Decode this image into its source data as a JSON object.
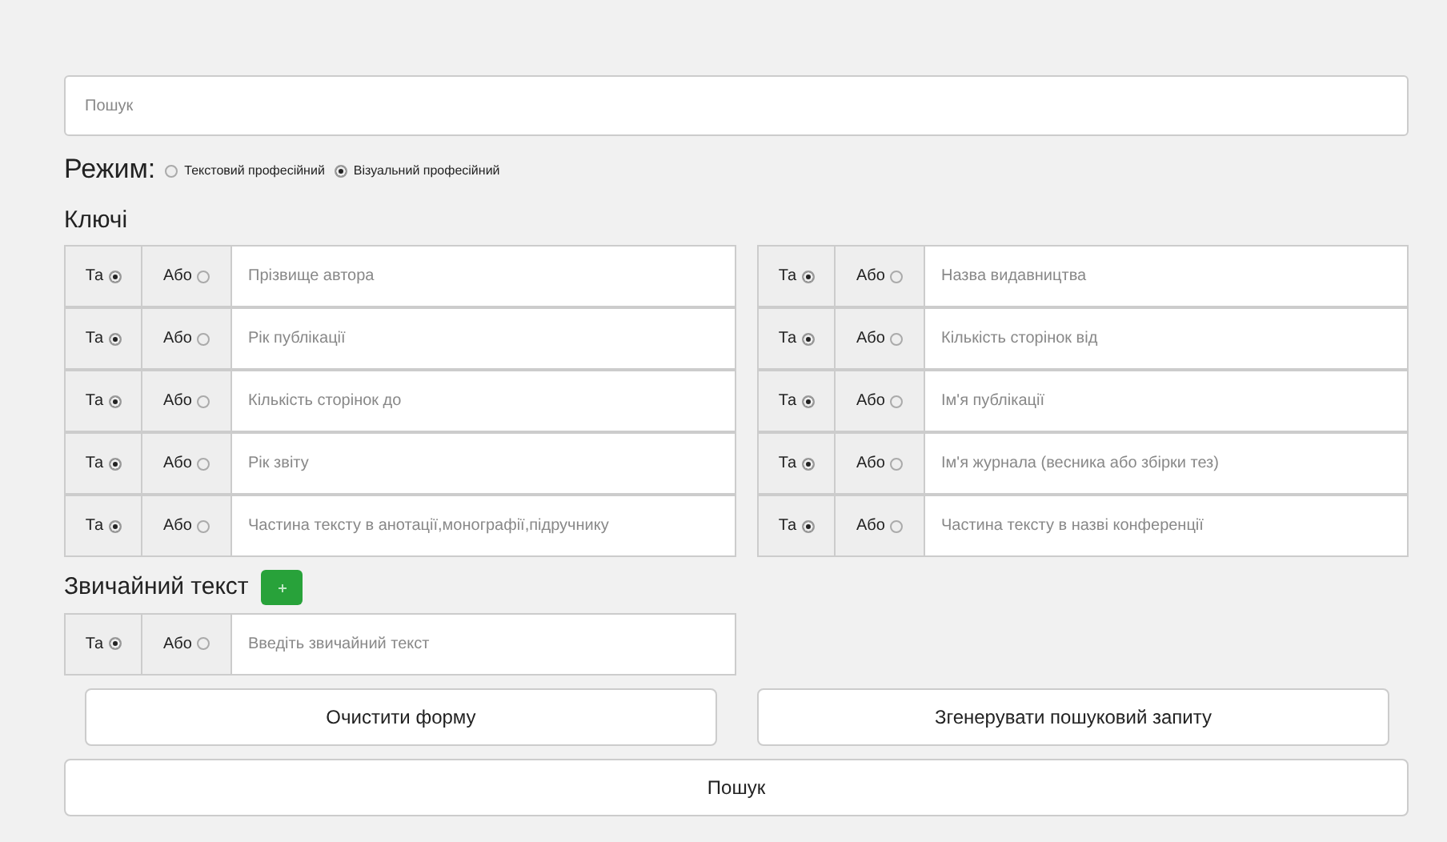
{
  "search": {
    "placeholder": "Пошук"
  },
  "mode": {
    "label": "Режим:",
    "options": [
      {
        "label": "Текстовий професійний",
        "selected": false
      },
      {
        "label": "Візуальний професійний",
        "selected": true
      }
    ]
  },
  "keys": {
    "title": "Ключі",
    "columns": [
      [
        {
          "operators": [
            {
              "label": "Та",
              "selected": true
            },
            {
              "label": "Або",
              "selected": false
            }
          ],
          "placeholder": "Прізвище автора"
        },
        {
          "operators": [
            {
              "label": "Та",
              "selected": true
            },
            {
              "label": "Або",
              "selected": false
            }
          ],
          "placeholder": "Рік публікації"
        },
        {
          "operators": [
            {
              "label": "Та",
              "selected": true
            },
            {
              "label": "Або",
              "selected": false
            }
          ],
          "placeholder": "Кількість сторінок до"
        },
        {
          "operators": [
            {
              "label": "Та",
              "selected": true
            },
            {
              "label": "Або",
              "selected": false
            }
          ],
          "placeholder": "Рік звіту"
        },
        {
          "operators": [
            {
              "label": "Та",
              "selected": true
            },
            {
              "label": "Або",
              "selected": false
            }
          ],
          "placeholder": "Частина тексту в анотації,монографії,підручнику"
        }
      ],
      [
        {
          "operators": [
            {
              "label": "Та",
              "selected": true
            },
            {
              "label": "Або",
              "selected": false
            }
          ],
          "placeholder": "Назва видавництва"
        },
        {
          "operators": [
            {
              "label": "Та",
              "selected": true
            },
            {
              "label": "Або",
              "selected": false
            }
          ],
          "placeholder": "Кількість сторінок від"
        },
        {
          "operators": [
            {
              "label": "Та",
              "selected": true
            },
            {
              "label": "Або",
              "selected": false
            }
          ],
          "placeholder": "Ім'я публікації"
        },
        {
          "operators": [
            {
              "label": "Та",
              "selected": true
            },
            {
              "label": "Або",
              "selected": false
            }
          ],
          "placeholder": "Ім'я журнала (весника або збірки тез)"
        },
        {
          "operators": [
            {
              "label": "Та",
              "selected": true
            },
            {
              "label": "Або",
              "selected": false
            }
          ],
          "placeholder": "Частина тексту в назві конференції"
        }
      ]
    ]
  },
  "plain_text": {
    "title": "Звичайний текст",
    "rows": [
      {
        "operators": [
          {
            "label": "Та",
            "selected": true
          },
          {
            "label": "Або",
            "selected": false
          }
        ],
        "placeholder": "Введіть звичайний текст"
      }
    ]
  },
  "buttons": [
    {
      "label": "Очистити форму"
    },
    {
      "label": "Згенерувати пошуковий запиту"
    }
  ],
  "submit": {
    "label": "Пошук"
  }
}
